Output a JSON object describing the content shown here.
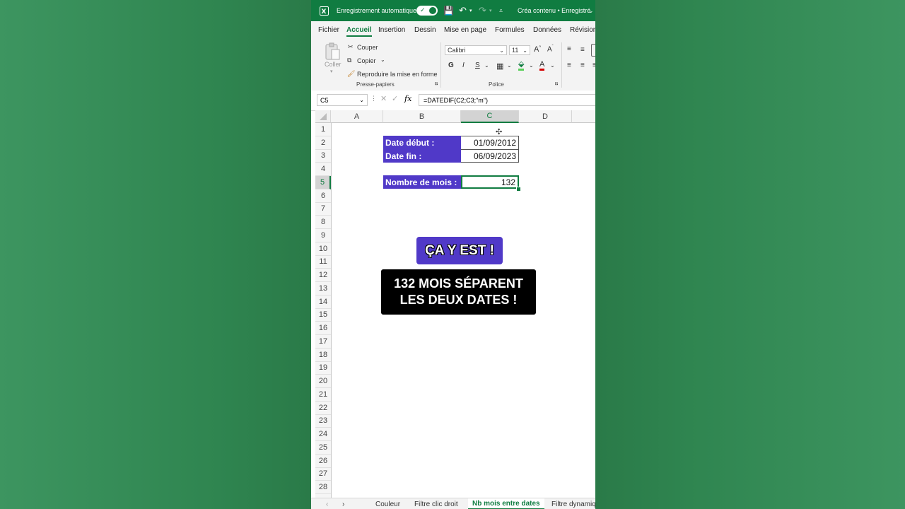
{
  "titlebar": {
    "autosave_label": "Enregistrement automatique",
    "doc_title": "Créa contenu • Enregistré"
  },
  "menu": {
    "tabs": [
      "Fichier",
      "Accueil",
      "Insertion",
      "Dessin",
      "Mise en page",
      "Formules",
      "Données",
      "Révision"
    ],
    "active": "Accueil"
  },
  "ribbon": {
    "clipboard": {
      "paste": "Coller",
      "cut": "Couper",
      "copy": "Copier",
      "format_painter": "Reproduire la mise en forme",
      "group_label": "Presse-papiers"
    },
    "font": {
      "name": "Calibri",
      "size": "11",
      "bold": "G",
      "italic": "I",
      "underline": "S",
      "group_label": "Police"
    }
  },
  "formula_bar": {
    "name_box": "C5",
    "formula": "=DATEDIF(C2;C3;\"m\")"
  },
  "columns": [
    "A",
    "B",
    "C",
    "D"
  ],
  "selected_column": "C",
  "rows": [
    "1",
    "2",
    "3",
    "4",
    "5",
    "6",
    "7",
    "8",
    "9",
    "10",
    "11",
    "12",
    "13",
    "14",
    "15",
    "16",
    "17",
    "18",
    "19",
    "20",
    "21",
    "22",
    "23",
    "24",
    "25",
    "26",
    "27",
    "28"
  ],
  "selected_row": "5",
  "cells": {
    "B2": "Date début :",
    "C2": "01/09/2012",
    "B3": "Date fin :",
    "C3": "06/09/2023",
    "B5": "Nombre de mois :",
    "C5": "132"
  },
  "overlay": {
    "badge1": "ÇA Y EST !",
    "badge2_line1": "132 MOIS SÉPARENT",
    "badge2_line2": "LES DEUX DATES !"
  },
  "sheets": [
    "Couleur",
    "Filtre clic droit",
    "Nb mois entre dates",
    "Filtre dynamique"
  ],
  "active_sheet": "Nb mois entre dates",
  "colors": {
    "excel_green": "#107c41",
    "label_purple": "#5039c8"
  }
}
